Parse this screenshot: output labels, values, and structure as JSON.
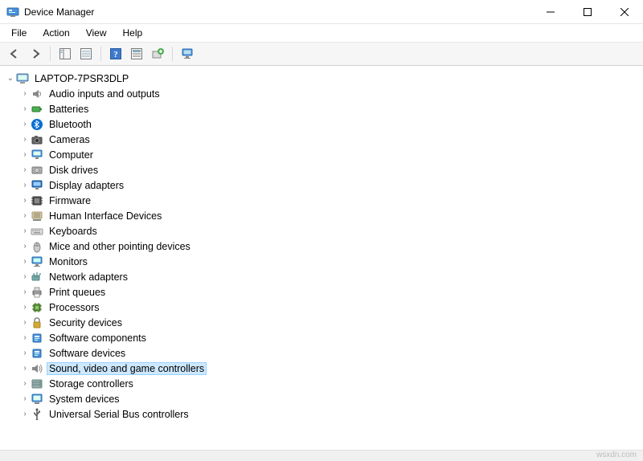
{
  "window": {
    "title": "Device Manager"
  },
  "menu": {
    "file": "File",
    "action": "Action",
    "view": "View",
    "help": "Help"
  },
  "tree": {
    "root": "LAPTOP-7PSR3DLP",
    "items": [
      {
        "name": "Audio inputs and outputs",
        "icon": "speaker",
        "selected": false
      },
      {
        "name": "Batteries",
        "icon": "battery",
        "selected": false
      },
      {
        "name": "Bluetooth",
        "icon": "bluetooth",
        "selected": false
      },
      {
        "name": "Cameras",
        "icon": "camera",
        "selected": false
      },
      {
        "name": "Computer",
        "icon": "computer",
        "selected": false
      },
      {
        "name": "Disk drives",
        "icon": "disk",
        "selected": false
      },
      {
        "name": "Display adapters",
        "icon": "display",
        "selected": false
      },
      {
        "name": "Firmware",
        "icon": "firmware",
        "selected": false
      },
      {
        "name": "Human Interface Devices",
        "icon": "hid",
        "selected": false
      },
      {
        "name": "Keyboards",
        "icon": "keyboard",
        "selected": false
      },
      {
        "name": "Mice and other pointing devices",
        "icon": "mouse",
        "selected": false
      },
      {
        "name": "Monitors",
        "icon": "monitor",
        "selected": false
      },
      {
        "name": "Network adapters",
        "icon": "network",
        "selected": false
      },
      {
        "name": "Print queues",
        "icon": "printer",
        "selected": false
      },
      {
        "name": "Processors",
        "icon": "processor",
        "selected": false
      },
      {
        "name": "Security devices",
        "icon": "security",
        "selected": false
      },
      {
        "name": "Software components",
        "icon": "software",
        "selected": false
      },
      {
        "name": "Software devices",
        "icon": "software",
        "selected": false
      },
      {
        "name": "Sound, video and game controllers",
        "icon": "sound",
        "selected": true
      },
      {
        "name": "Storage controllers",
        "icon": "storage",
        "selected": false
      },
      {
        "name": "System devices",
        "icon": "system",
        "selected": false
      },
      {
        "name": "Universal Serial Bus controllers",
        "icon": "usb",
        "selected": false
      }
    ]
  },
  "watermark": "wsxdn.com"
}
